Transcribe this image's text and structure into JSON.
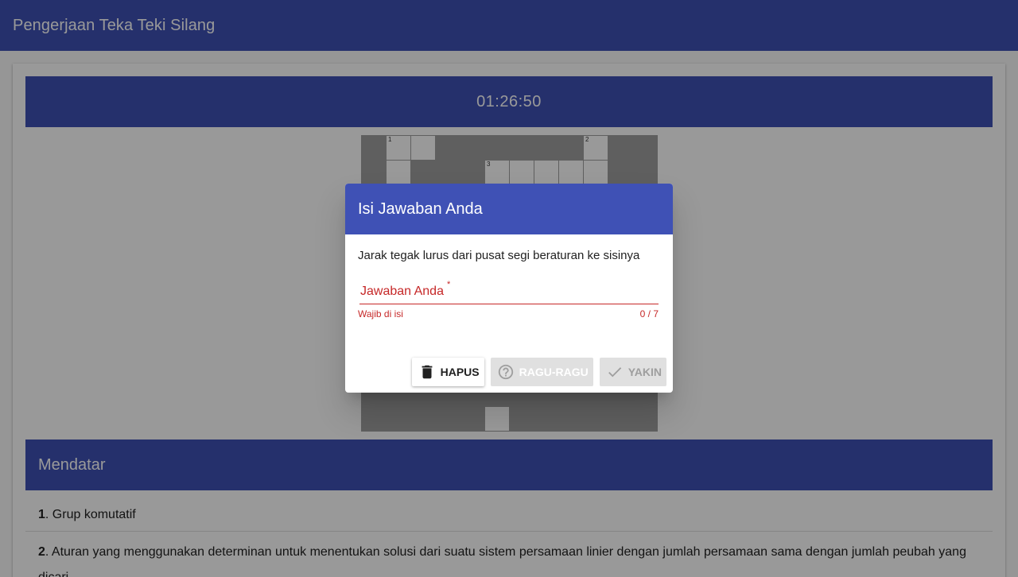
{
  "app": {
    "title": "Pengerjaan Teka Teki Silang"
  },
  "timer": {
    "value": "01:26:50"
  },
  "crossword": {
    "rows": [
      [
        "B",
        "W1",
        "W",
        "B",
        "B",
        "B",
        "B",
        "B",
        "B",
        "W2",
        "B",
        "B"
      ],
      [
        "B",
        "W",
        "B",
        "B",
        "B",
        "W3",
        "W",
        "W",
        "W",
        "W",
        "B",
        "B"
      ],
      [
        "B",
        "B",
        "B",
        "B",
        "B",
        "B",
        "B",
        "B",
        "B",
        "B",
        "B",
        "B"
      ],
      [
        "B",
        "B",
        "B",
        "B",
        "B",
        "B",
        "B",
        "B",
        "B",
        "B",
        "B",
        "B"
      ],
      [
        "B",
        "B",
        "B",
        "B",
        "B",
        "B",
        "B",
        "B",
        "B",
        "B",
        "B",
        "B"
      ],
      [
        "B",
        "B",
        "B",
        "B",
        "B",
        "B",
        "B",
        "B",
        "B",
        "B",
        "B",
        "B"
      ],
      [
        "B",
        "B",
        "B",
        "B",
        "B",
        "B",
        "B",
        "B",
        "B",
        "B",
        "B",
        "B"
      ],
      [
        "B",
        "B",
        "B",
        "B",
        "B",
        "B",
        "B",
        "B",
        "B",
        "B",
        "B",
        "B"
      ],
      [
        "B",
        "B",
        "B",
        "B",
        "B",
        "B",
        "B",
        "B",
        "B",
        "B",
        "B",
        "B"
      ],
      [
        "B",
        "B",
        "B",
        "B",
        "B",
        "B",
        "B",
        "B",
        "B",
        "B",
        "B",
        "B"
      ],
      [
        "B",
        "B",
        "B",
        "B",
        "B",
        "B",
        "B",
        "B",
        "B",
        "B",
        "B",
        "B"
      ],
      [
        "B",
        "B",
        "B",
        "B",
        "B",
        "W",
        "B",
        "B",
        "B",
        "B",
        "B",
        "B"
      ]
    ]
  },
  "across_section": {
    "title": "Mendatar",
    "clues": [
      {
        "number": "1",
        "text": ". Grup komutatif"
      },
      {
        "number": "2",
        "text": ". Aturan yang menggunakan determinan untuk menentukan solusi dari suatu sistem persamaan linier dengan jumlah persamaan sama dengan jumlah peubah yang dicari"
      }
    ]
  },
  "dialog": {
    "title": "Isi Jawaban Anda",
    "question": "Jarak tegak lurus dari pusat segi beraturan ke sisinya",
    "input": {
      "placeholder": "Jawaban Anda",
      "required_mark": "*",
      "value": ""
    },
    "error": "Wajib di isi",
    "counter": "0 / 7",
    "buttons": {
      "delete": "HAPUS",
      "doubt": "RAGU-RAGU",
      "sure": "YAKIN"
    }
  },
  "colors": {
    "primary": "#3f51b5",
    "error": "#c62828",
    "grid_black": "#9e9e9e"
  }
}
